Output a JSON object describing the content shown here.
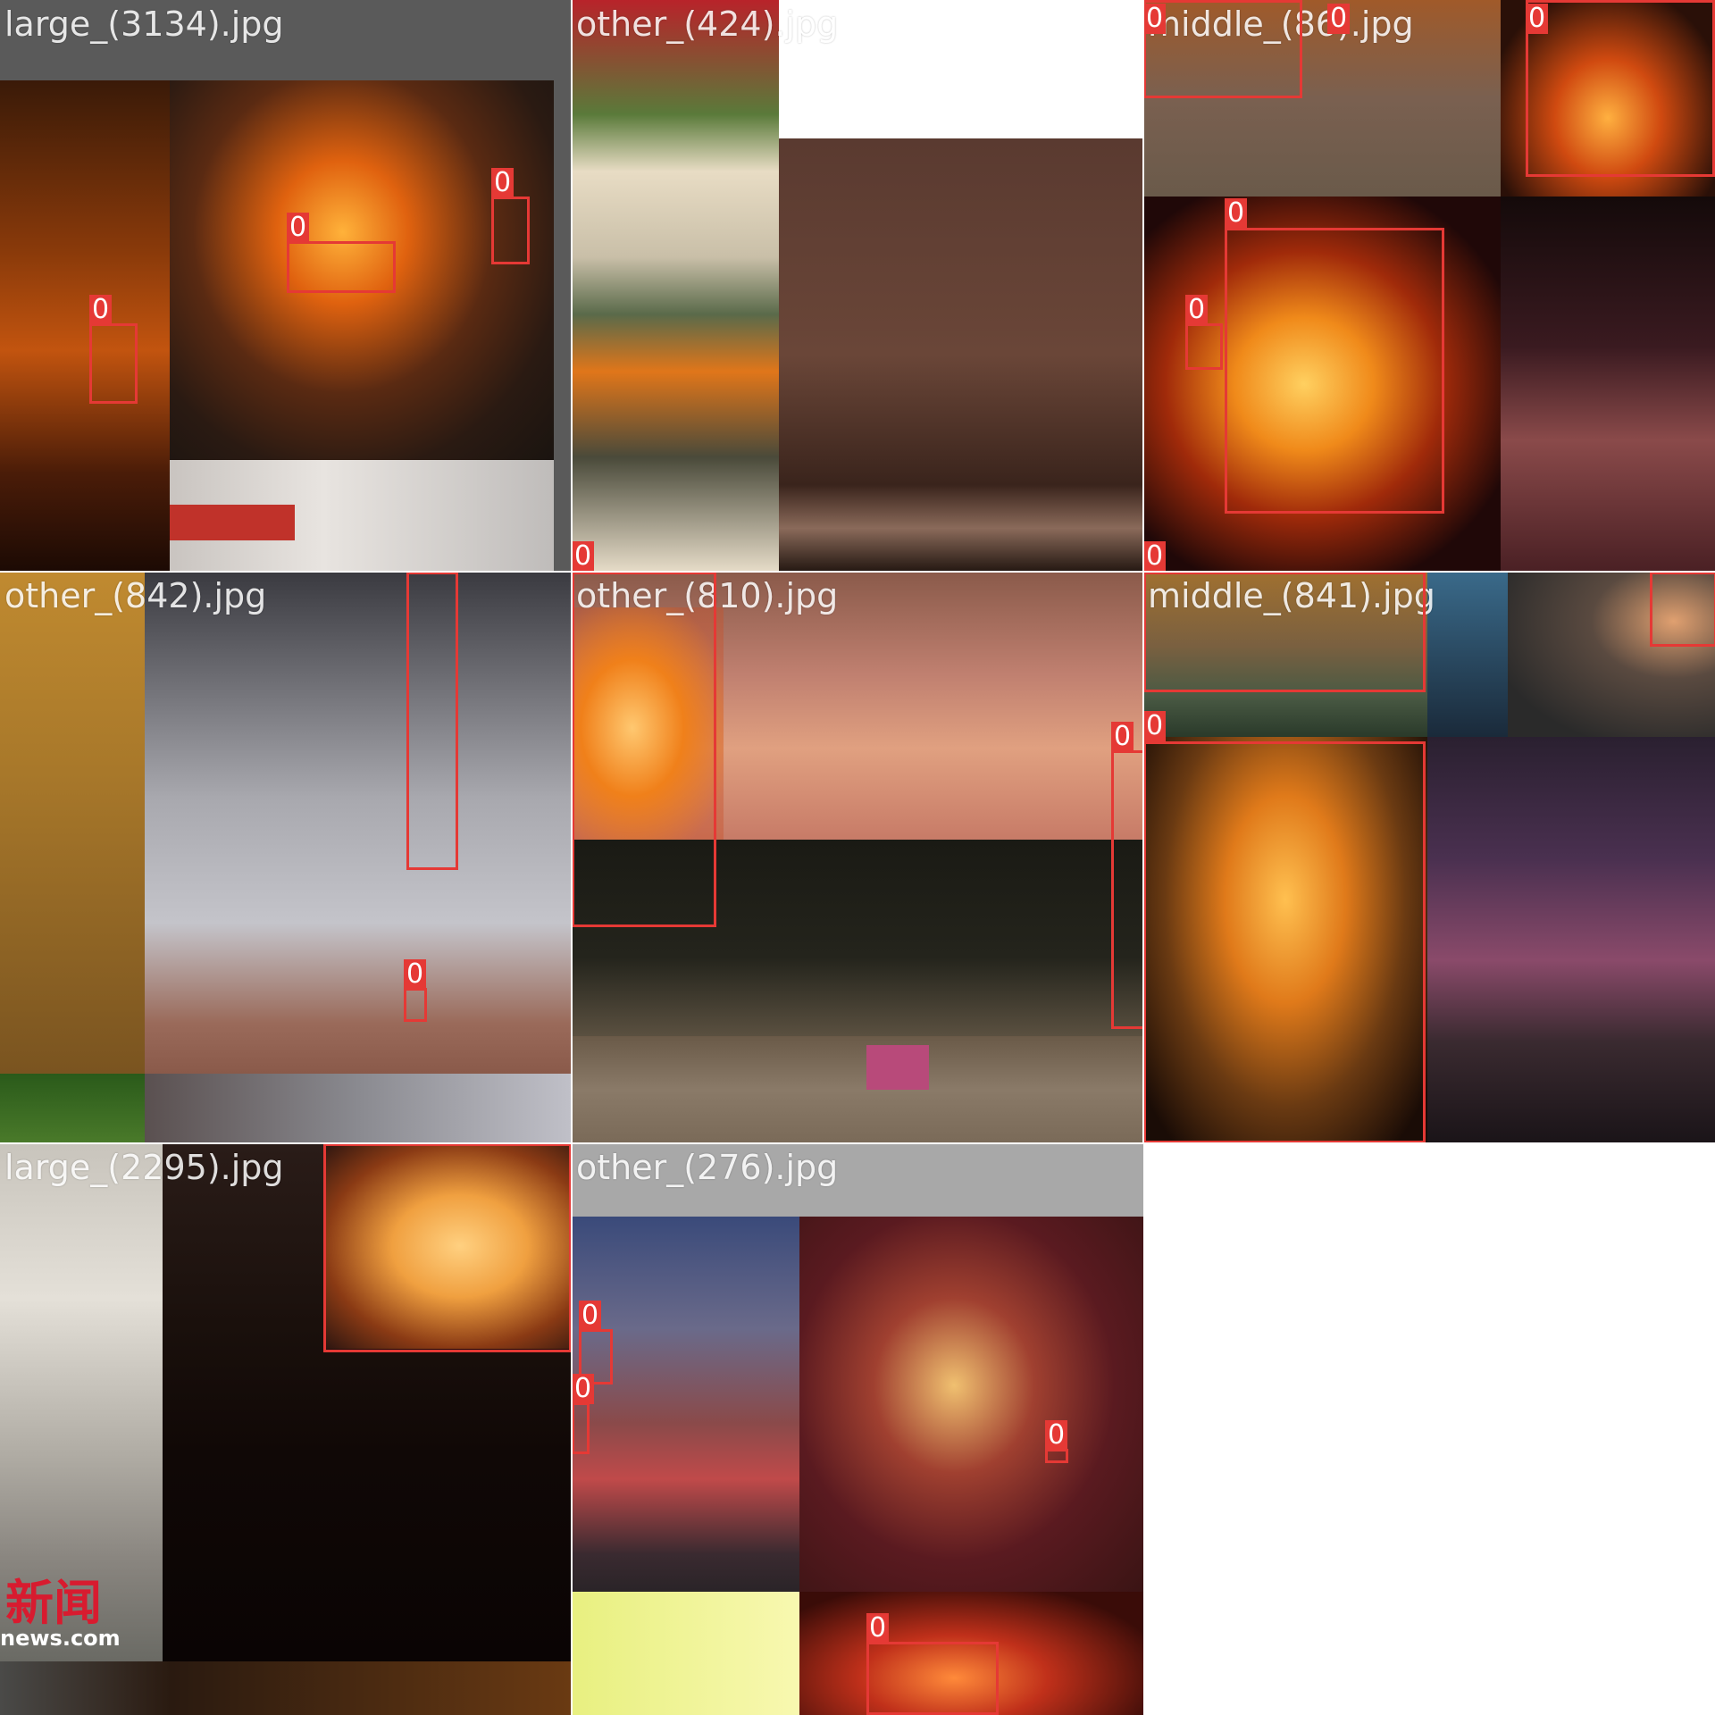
{
  "tiles": [
    {
      "filename": "large_(3134).jpg",
      "labels": [
        "0",
        "0",
        "0"
      ]
    },
    {
      "filename": "other_(424).jpg",
      "labels": [
        "0"
      ]
    },
    {
      "filename": "middle_(86).jpg",
      "labels": [
        "0",
        "0",
        "0",
        "0",
        "0",
        "0"
      ]
    },
    {
      "filename": "other_(842).jpg",
      "labels": [
        "0",
        "0"
      ]
    },
    {
      "filename": "other_(810).jpg",
      "labels": [
        "0",
        "0"
      ]
    },
    {
      "filename": "middle_(841).jpg",
      "labels": [
        "0",
        "0",
        "0"
      ]
    },
    {
      "filename": "large_(2295).jpg",
      "labels": [
        "0"
      ],
      "watermark_text": "新闻",
      "watermark_url": "news.com"
    },
    {
      "filename": "other_(276).jpg",
      "labels": [
        "0",
        "0",
        "0",
        "0"
      ]
    }
  ],
  "colors": {
    "box": "#e53935",
    "label_text": "#ffffff",
    "background": "#ffffff"
  }
}
